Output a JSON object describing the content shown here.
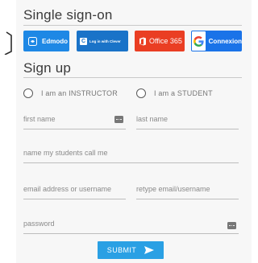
{
  "sso": {
    "title": "Single sign-on",
    "buttons": [
      {
        "label": "Edmodo",
        "icon": "edmodo-icon",
        "color": "#1e88e5"
      },
      {
        "label": "Log in with Clever",
        "icon": "clever-icon",
        "color": "#1a73c8"
      },
      {
        "label": "Office 365",
        "icon": "office-icon",
        "color": "#ea3e23"
      },
      {
        "label": "Connexion",
        "icon": "google-icon",
        "color": "#1a73e8"
      }
    ]
  },
  "signup": {
    "title": "Sign up",
    "roles": [
      {
        "label": "I am an INSTRUCTOR"
      },
      {
        "label": "I am a STUDENT"
      }
    ],
    "fields": {
      "first_name": "first name",
      "last_name": "last name",
      "nickname": "name my students call me",
      "email": "email address or username",
      "retype_email": "retype email/username",
      "password": "password"
    },
    "submit_label": "SUBMIT"
  },
  "colors": {
    "accent": "#2aa0e4",
    "panel": "#f7f7f7"
  }
}
